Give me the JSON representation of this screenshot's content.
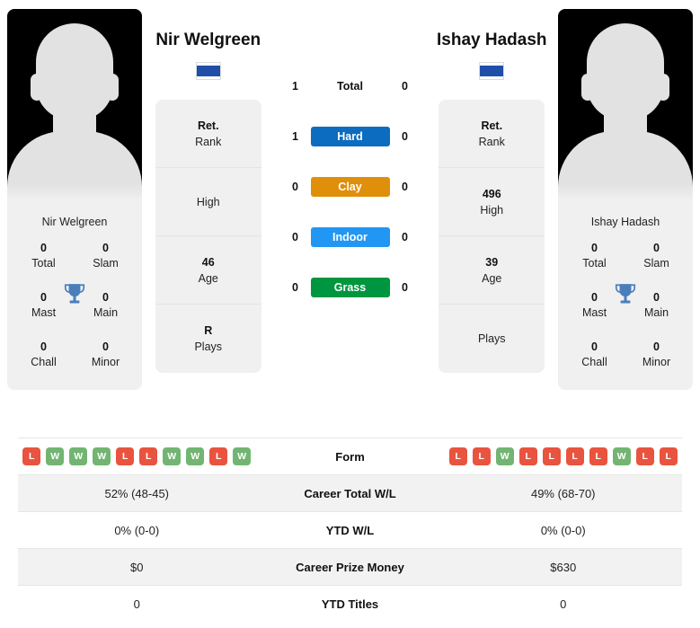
{
  "players": {
    "left": {
      "name": "Nir Welgreen",
      "card_name": "Nir Welgreen",
      "country": "Israel",
      "flag": "israel-flag",
      "titles": [
        {
          "value": "0",
          "label": "Total"
        },
        {
          "value": "0",
          "label": "Slam"
        },
        {
          "value": "0",
          "label": "Mast"
        },
        {
          "value": "0",
          "label": "Main"
        },
        {
          "value": "0",
          "label": "Chall"
        },
        {
          "value": "0",
          "label": "Minor"
        }
      ],
      "info": [
        {
          "value": "Ret.",
          "label": "Rank"
        },
        {
          "value": "",
          "label": "High"
        },
        {
          "value": "46",
          "label": "Age"
        },
        {
          "value": "R",
          "label": "Plays"
        }
      ],
      "form": [
        "L",
        "W",
        "W",
        "W",
        "L",
        "L",
        "W",
        "W",
        "L",
        "W"
      ],
      "career_total_wl": "52% (48-45)",
      "ytd_wl": "0% (0-0)",
      "career_prize_money": "$0",
      "ytd_titles": "0"
    },
    "right": {
      "name": "Ishay Hadash",
      "card_name": "Ishay Hadash",
      "country": "Israel",
      "flag": "israel-flag",
      "titles": [
        {
          "value": "0",
          "label": "Total"
        },
        {
          "value": "0",
          "label": "Slam"
        },
        {
          "value": "0",
          "label": "Mast"
        },
        {
          "value": "0",
          "label": "Main"
        },
        {
          "value": "0",
          "label": "Chall"
        },
        {
          "value": "0",
          "label": "Minor"
        }
      ],
      "info": [
        {
          "value": "Ret.",
          "label": "Rank"
        },
        {
          "value": "496",
          "label": "High"
        },
        {
          "value": "39",
          "label": "Age"
        },
        {
          "value": "",
          "label": "Plays"
        }
      ],
      "form": [
        "L",
        "L",
        "W",
        "L",
        "L",
        "L",
        "L",
        "W",
        "L",
        "L"
      ],
      "career_total_wl": "49% (68-70)",
      "ytd_wl": "0% (0-0)",
      "career_prize_money": "$630",
      "ytd_titles": "0"
    }
  },
  "surfaces": [
    {
      "label": "Total",
      "left": "1",
      "right": "0",
      "color": "",
      "style": "plain"
    },
    {
      "label": "Hard",
      "left": "1",
      "right": "0",
      "color": "#0c6cbf",
      "style": "filled"
    },
    {
      "label": "Clay",
      "left": "0",
      "right": "0",
      "color": "#e08f0a",
      "style": "filled"
    },
    {
      "label": "Indoor",
      "left": "0",
      "right": "0",
      "color": "#2196f3",
      "style": "filled"
    },
    {
      "label": "Grass",
      "left": "0",
      "right": "0",
      "color": "#00963f",
      "style": "filled"
    }
  ],
  "table": {
    "rows": [
      {
        "label": "Form",
        "type": "form",
        "key": "form"
      },
      {
        "label": "Career Total W/L",
        "type": "text",
        "key": "career_total_wl"
      },
      {
        "label": "YTD W/L",
        "type": "text",
        "key": "ytd_wl"
      },
      {
        "label": "Career Prize Money",
        "type": "text",
        "key": "career_prize_money"
      },
      {
        "label": "YTD Titles",
        "type": "text",
        "key": "ytd_titles"
      }
    ]
  },
  "colors": {
    "card_bg": "#f0f0f0",
    "row_alt": "#f2f2f2",
    "win_badge": "#72b572",
    "loss_badge": "#e8543f",
    "trophy": "#4a7ebb",
    "flag_blue": "#1f4fa8"
  }
}
